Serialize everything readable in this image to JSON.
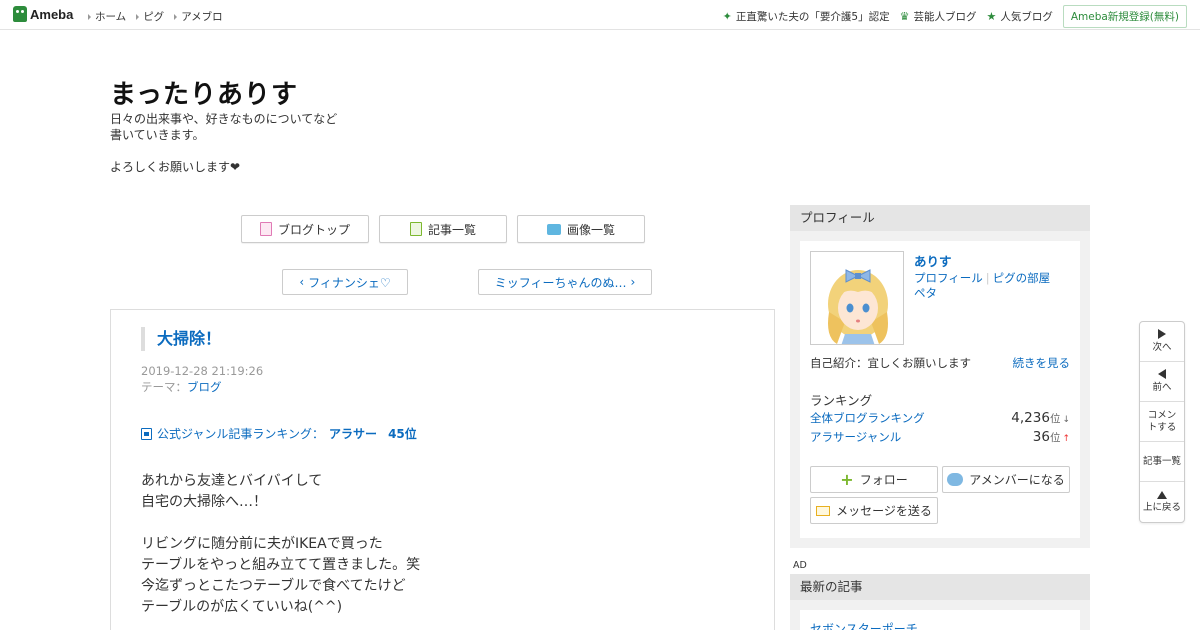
{
  "topbar": {
    "logo_text": "Ameba",
    "nav": [
      "ホーム",
      "ピグ",
      "アメブロ"
    ],
    "right_links": [
      {
        "label": "正直驚いた夫の「要介護5」認定",
        "icon": "sparkle-icon"
      },
      {
        "label": "芸能人ブログ",
        "icon": "crown-icon"
      },
      {
        "label": "人気ブログ",
        "icon": "star-icon"
      }
    ],
    "register_label": "Ameba新規登録(無料)"
  },
  "blog": {
    "title": "まったりありす",
    "description": "日々の出来事や、好きなものについてなど\n書いていきます。\n\nよろしくお願いします❤"
  },
  "nav_buttons": {
    "top": "ブログトップ",
    "entries": "記事一覧",
    "images": "画像一覧"
  },
  "pager": {
    "prev": "フィナンシェ♡",
    "next": "ミッフィーちゃんのぬ…"
  },
  "article": {
    "title": "大掃除！",
    "date": "2019-12-28 21:19:26",
    "theme_label": "テーマ：",
    "theme": "ブログ",
    "ranking_label": "公式ジャンル記事ランキング：",
    "ranking_genre": "アラサー",
    "ranking_position": "45位",
    "body": "あれから友達とバイバイして\n自宅の大掃除へ…！\n\nリビングに随分前に夫がIKEAで買った\nテーブルをやっと組み立てて置きました。笑\n今迄ずっとこたつテーブルで食べてたけど\nテーブルのが広くていいね(^^)"
  },
  "profile": {
    "header": "プロフィール",
    "name": "ありす",
    "link_profile": "プロフィール",
    "link_pig": "ピグの部屋",
    "link_peta": "ペタ",
    "intro": "自己紹介：宜しくお願いします",
    "more": "続きを見る",
    "ranking_title": "ランキング",
    "rank_overall_label": "全体ブログランキング",
    "rank_overall_value": "4,236",
    "rank_overall_unit": "位",
    "rank_overall_trend": "↓",
    "rank_genre_label": "アラサージャンル",
    "rank_genre_value": "36",
    "rank_genre_unit": "位",
    "rank_genre_trend": "↑",
    "follow": "フォロー",
    "amember": "アメンバーになる",
    "message": "メッセージを送る"
  },
  "ad_label": "AD",
  "recent": {
    "header": "最新の記事",
    "first_item": "セボンスターポーチ"
  },
  "floatnav": {
    "next": "次へ",
    "prev": "前へ",
    "comment": "コメントする",
    "entries": "記事一覧",
    "top": "上に戻る"
  },
  "colors": {
    "link": "#0b6bbf",
    "brand_green": "#2d8c3c",
    "sidebar_bg": "#f1f1f1",
    "sidebar_header": "#e5e5e5"
  }
}
